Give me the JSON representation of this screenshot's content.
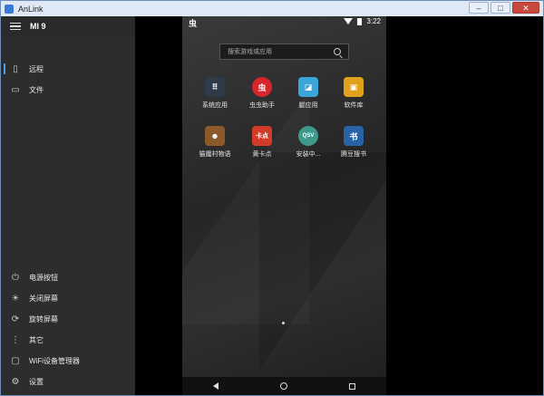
{
  "window": {
    "title": "AnLink",
    "controls": {
      "minimize": "–",
      "maximize": "□",
      "close": "✕"
    }
  },
  "sidebar": {
    "device_name": "MI 9",
    "top_items": [
      {
        "label": "远程",
        "icon": "phone-icon"
      },
      {
        "label": "文件",
        "icon": "folder-icon"
      }
    ],
    "bottom_items": [
      {
        "label": "电源按钮",
        "icon": "power-icon"
      },
      {
        "label": "关闭屏幕",
        "icon": "bulb-icon"
      },
      {
        "label": "旋转屏幕",
        "icon": "rotate-icon"
      },
      {
        "label": "其它",
        "icon": "more-vertical-icon"
      },
      {
        "label": "WiFi设备管理器",
        "icon": "wifi-device-icon"
      },
      {
        "label": "设置",
        "icon": "gear-icon"
      }
    ]
  },
  "phone": {
    "status": {
      "logo": "虫",
      "time": "3:22"
    },
    "search_placeholder": "搜索游戏或应用",
    "apps": [
      {
        "name": "系统应用",
        "icon_text": "⠿",
        "color": "#2f3a4a"
      },
      {
        "name": "虫虫助手",
        "icon_text": "虫",
        "color": "#d7262b"
      },
      {
        "name": "腿应用",
        "icon_text": "◪",
        "color": "#3aa5d6"
      },
      {
        "name": "软件库",
        "icon_text": "▣",
        "color": "#e0a21c"
      },
      {
        "name": "猫魔村物语",
        "icon_text": "☻",
        "color": "#8a5a2b"
      },
      {
        "name": "黄卡点",
        "icon_text": "卡点",
        "color": "#d23a2a"
      },
      {
        "name": "安装中...",
        "icon_text": "QSV",
        "color": "#3f9a8e"
      },
      {
        "name": "腾豆搜书",
        "icon_text": "书",
        "color": "#2a62a8"
      }
    ]
  }
}
